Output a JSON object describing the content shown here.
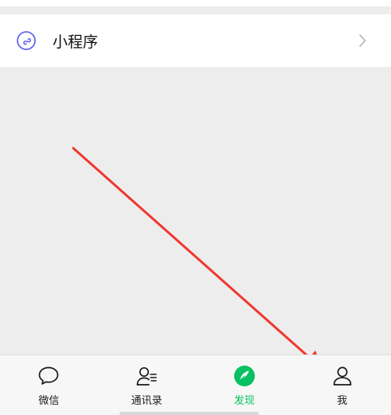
{
  "list": {
    "mini_programs": {
      "label": "小程序",
      "icon": "mini-program-icon",
      "icon_color": "#6467f0"
    }
  },
  "tabbar": {
    "active_color": "#07c160",
    "tabs": [
      {
        "label": "微信",
        "icon": "chat-bubble-icon",
        "active": false
      },
      {
        "label": "通讯录",
        "icon": "contacts-icon",
        "active": false
      },
      {
        "label": "发现",
        "icon": "compass-icon",
        "active": true
      },
      {
        "label": "我",
        "icon": "person-icon",
        "active": false
      }
    ]
  },
  "annotation": {
    "arrow_color": "#f0372f"
  }
}
